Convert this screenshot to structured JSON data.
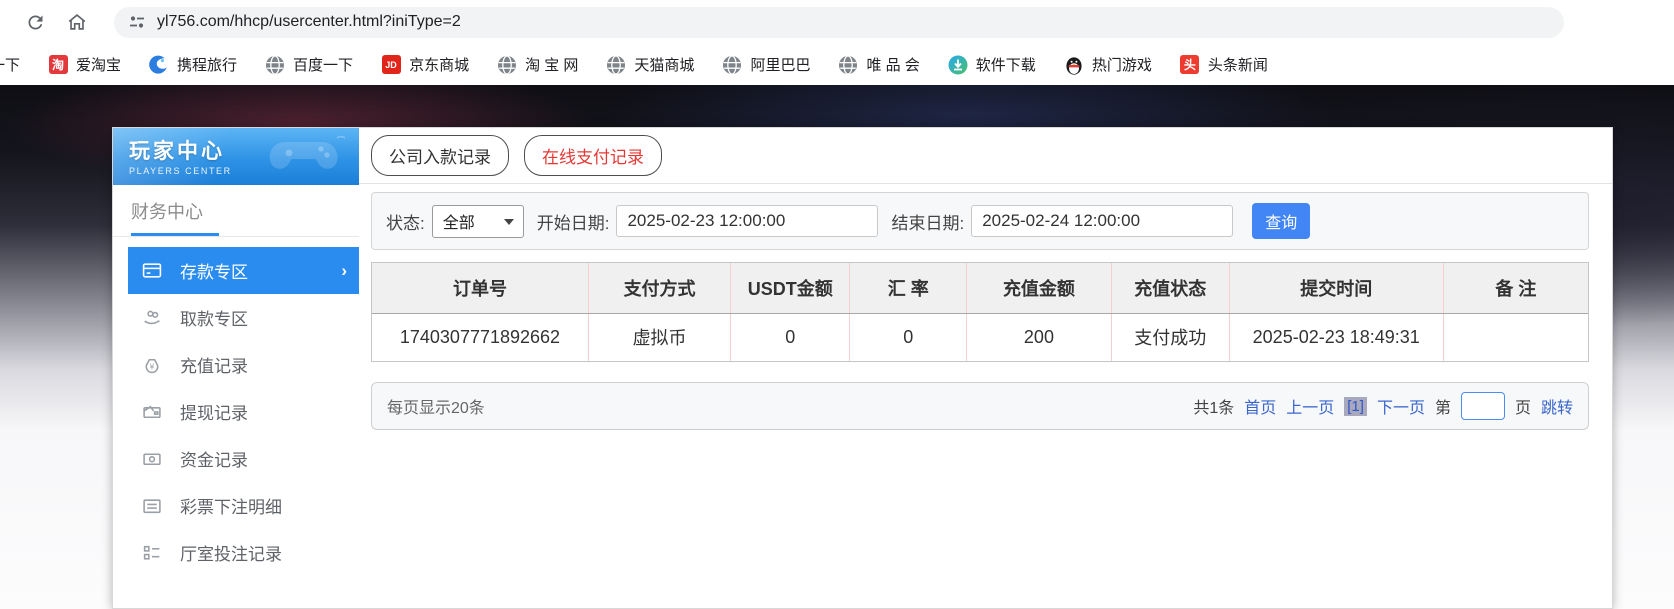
{
  "browser": {
    "url": "yl756.com/hhcp/usercenter.html?iniType=2",
    "icons": [
      "reload-icon",
      "home-icon",
      "site-settings-icon"
    ],
    "bookmarks": [
      {
        "label": "一下",
        "icon": "none"
      },
      {
        "label": "爱淘宝",
        "icon": "taobao-icon",
        "icon_text": "淘"
      },
      {
        "label": "携程旅行",
        "icon": "ctrip-icon"
      },
      {
        "label": "百度一下",
        "icon": "globe-icon"
      },
      {
        "label": "京东商城",
        "icon": "jd-icon",
        "icon_text": "JD"
      },
      {
        "label": "淘 宝 网",
        "icon": "globe-icon"
      },
      {
        "label": "天猫商城",
        "icon": "globe-icon"
      },
      {
        "label": "阿里巴巴",
        "icon": "globe-icon"
      },
      {
        "label": "唯 品 会",
        "icon": "globe-icon"
      },
      {
        "label": "软件下载",
        "icon": "software-download-icon"
      },
      {
        "label": "热门游戏",
        "icon": "penguin-icon"
      },
      {
        "label": "头条新闻",
        "icon": "toutiao-icon",
        "icon_text": "头"
      }
    ]
  },
  "sidebar": {
    "title": "玩家中心",
    "subtitle": "PLAYERS CENTER",
    "section": "财务中心",
    "items": [
      {
        "label": "存款专区",
        "icon": "deposit-icon",
        "active": true,
        "chevron": "›"
      },
      {
        "label": "取款专区",
        "icon": "withdraw-icon",
        "active": false
      },
      {
        "label": "充值记录",
        "icon": "recharge-record-icon",
        "active": false
      },
      {
        "label": "提现记录",
        "icon": "cashout-record-icon",
        "active": false
      },
      {
        "label": "资金记录",
        "icon": "funds-record-icon",
        "active": false
      },
      {
        "label": "彩票下注明细",
        "icon": "lottery-detail-icon",
        "active": false
      },
      {
        "label": "厅室投注记录",
        "icon": "hall-bet-icon",
        "active": false
      }
    ]
  },
  "tabs": {
    "company": "公司入款记录",
    "online": "在线支付记录"
  },
  "filters": {
    "status_label": "状态:",
    "status_value": "全部",
    "start_label": "开始日期:",
    "start_value": "2025-02-23 12:00:00",
    "end_label": "结束日期:",
    "end_value": "2025-02-24 12:00:00",
    "search_label": "查询"
  },
  "table": {
    "headers": [
      "订单号",
      "支付方式",
      "USDT金额",
      "汇 率",
      "充值金额",
      "充值状态",
      "提交时间",
      "备 注"
    ],
    "rows": [
      [
        "1740307771892662",
        "虚拟币",
        "0",
        "0",
        "200",
        "支付成功",
        "2025-02-23 18:49:31",
        ""
      ]
    ]
  },
  "pagination": {
    "page_size_text": "每页显示20条",
    "total_text": "共1条",
    "first": "首页",
    "prev": "上一页",
    "current": "[1]",
    "next": "下一页",
    "jump_prefix": "第",
    "jump_value": "",
    "jump_suffix": "页",
    "jump_action": "跳转"
  },
  "colors": {
    "accent_blue": "#2b8cf0",
    "button_blue": "#4285f4",
    "link_blue": "#3a66cc",
    "tab_red": "#e53935"
  }
}
